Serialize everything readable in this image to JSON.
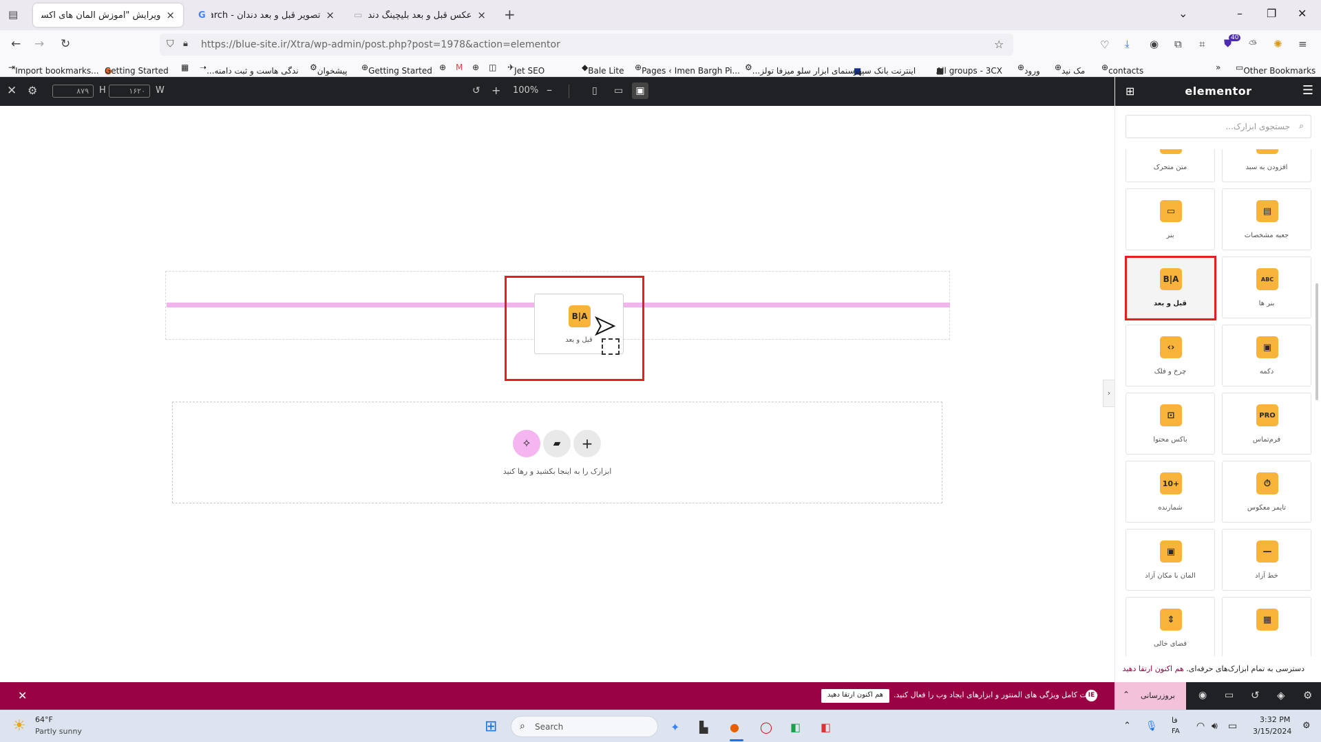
{
  "browser": {
    "tabs": [
      {
        "label": "ویرایش \"آموزش المان های اکسترا –",
        "active": true
      },
      {
        "label": "تصویر قبل و بعد دندان - Search",
        "active": false
      },
      {
        "label": "عکس قبل و بعد بلیچینگ دندان",
        "active": false
      }
    ],
    "new_tab": "+",
    "url": "https://blue-site.ir/Xtra/wp-admin/post.php?post=1978&action=elementor",
    "extension_badge": "40",
    "bookmarks": [
      "Import bookmarks...",
      "Getting Started",
      "...ندگی هاست و ثبت دامنه",
      "پیشخوان",
      "Getting Started",
      "Jet SEO",
      "Bale Lite",
      "Pages ‹ Imen Bargh Pi...",
      "...سنمای ابزار سلو میزفا تولز",
      "اینترنت بانک سپهر",
      "All groups - 3CX",
      "ورود",
      "مک نید",
      "contacts"
    ],
    "other_bookmarks": "Other Bookmarks"
  },
  "editor_toolbar": {
    "height_value": "۸۷۹",
    "height_label": "H",
    "width_value": "۱۶۲۰",
    "width_label": "W",
    "zoom": "100%"
  },
  "canvas": {
    "drag_widget_label": "قبل و بعد",
    "drag_widget_icon": "B|A",
    "drop_zone_text": "ابزارک را به اینجا بکشید و رها کنید"
  },
  "sidebar": {
    "brand": "elementor",
    "search_placeholder": "جستجوی ابزارک...",
    "widgets": [
      {
        "label": "متن متحرک",
        "icon": "¶"
      },
      {
        "label": "افزودن به سبد",
        "icon": "⊕"
      },
      {
        "label": "بنر",
        "icon": "▭"
      },
      {
        "label": "جعبه مشخصات",
        "icon": "▤"
      },
      {
        "label": "قبل و بعد",
        "icon": "B|A"
      },
      {
        "label": "بنر ها",
        "icon": "ABC"
      },
      {
        "label": "چرخ و فلک",
        "icon": "‹›"
      },
      {
        "label": "دکمه",
        "icon": "▣"
      },
      {
        "label": "باکس محتوا",
        "icon": "⊡"
      },
      {
        "label": "فرم‌تماس",
        "icon": "PRO"
      },
      {
        "label": "شمارنده",
        "icon": "10+"
      },
      {
        "label": "تایمر معکوس",
        "icon": "⏱"
      },
      {
        "label": "المان با مکان آزاد",
        "icon": "▣"
      },
      {
        "label": "خط آزاد",
        "icon": "—"
      },
      {
        "label": "فضای خالی",
        "icon": "⇕"
      },
      {
        "label": "",
        "icon": "▦"
      }
    ],
    "upgrade_text": "دسترسی به تمام ابزارک‌های حرفه‌ای.",
    "upgrade_link": "هم اکنون ارتقا دهید",
    "footer_update": "بروزرسانی"
  },
  "notice_bar": {
    "text": "قدرت کامل ویژگی های المنتور و ابزارهای ایجاد وب را فعال کنید.",
    "button": "هم اکنون ارتقا دهید"
  },
  "taskbar": {
    "weather_temp": "64°F",
    "weather_desc": "Partly sunny",
    "search_placeholder": "Search",
    "lang_top": "فا",
    "lang_bottom": "FA",
    "time": "3:32 PM",
    "date": "3/15/2024"
  },
  "colors": {
    "accent": "#9a0343",
    "widget_icon": "#f8b33a",
    "highlight": "#e51e25",
    "drop_line": "#f0b5ea"
  }
}
